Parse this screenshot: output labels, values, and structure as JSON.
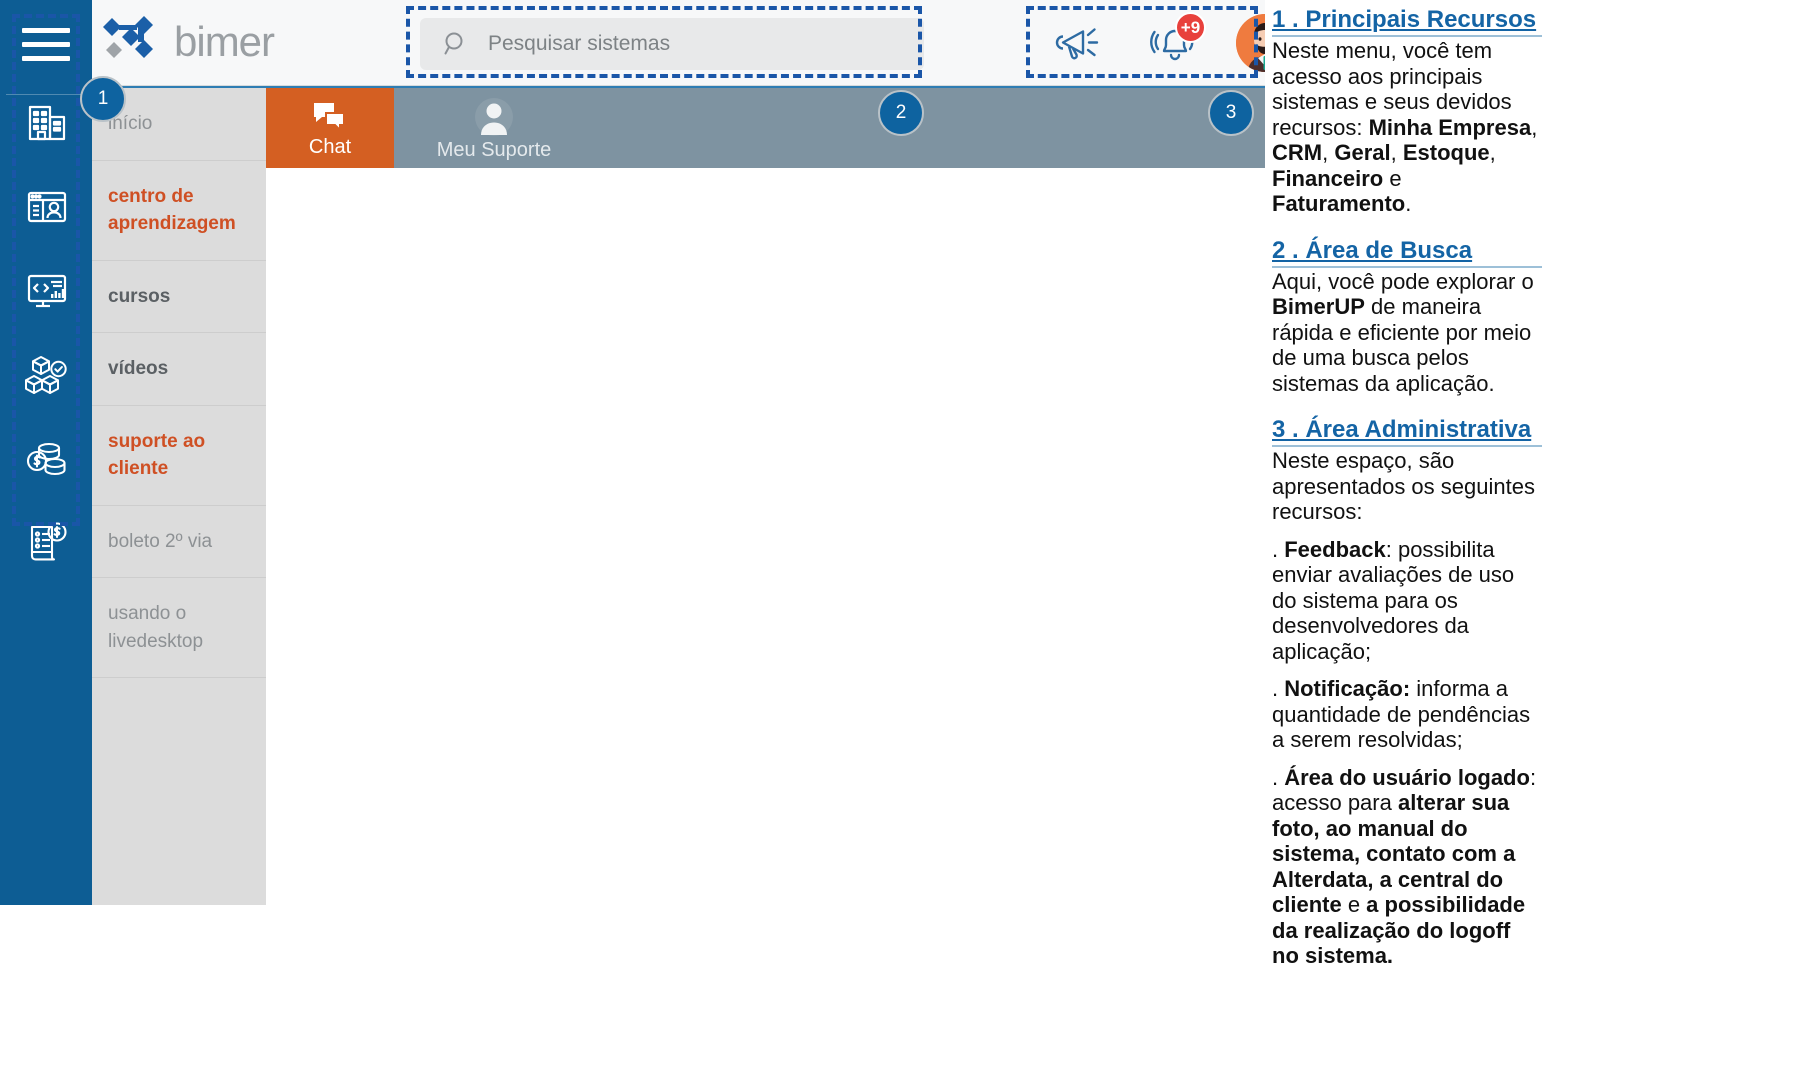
{
  "app": {
    "brand": "bimer",
    "brand_logo_icon": "bimer-logo-icon"
  },
  "icon_rail": {
    "menu_icon": "hamburger-menu-icon",
    "items": [
      {
        "icon": "building-icon",
        "label": "Minha Empresa"
      },
      {
        "icon": "contact-card-icon",
        "label": "CRM"
      },
      {
        "icon": "code-monitor-icon",
        "label": "Geral"
      },
      {
        "icon": "boxes-check-icon",
        "label": "Estoque"
      },
      {
        "icon": "coins-icon",
        "label": "Financeiro"
      },
      {
        "icon": "invoice-dollar-icon",
        "label": "Faturamento"
      }
    ]
  },
  "search": {
    "placeholder": "Pesquisar sistemas",
    "value": "",
    "icon": "search-icon"
  },
  "admin_area": {
    "feedback_icon": "megaphone-icon",
    "notification_icon": "bell-icon",
    "notification_badge": "+9",
    "avatar_icon": "user-avatar"
  },
  "left_nav": {
    "items": [
      {
        "label": "início",
        "style": "muted"
      },
      {
        "label": "centro de aprendizagem",
        "style": "accent"
      },
      {
        "label": "cursos",
        "style": "bold"
      },
      {
        "label": "vídeos",
        "style": "bold"
      },
      {
        "label": "suporte ao cliente",
        "style": "accent"
      },
      {
        "label": "boleto 2º via",
        "style": "muted"
      },
      {
        "label": "usando o livedesktop",
        "style": "muted"
      }
    ]
  },
  "tabs": [
    {
      "label": "Chat",
      "icon": "chat-bubbles-icon",
      "active": true
    },
    {
      "label": "Meu Suporte",
      "icon": "person-circle-icon",
      "active": false
    }
  ],
  "callouts": {
    "one": "1",
    "two": "2",
    "three": "3"
  },
  "notes": {
    "s1": {
      "heading": "1 . Principais Recursos",
      "body_1": "Neste menu, você tem acesso aos principais sistemas e seus devidos recursos: ",
      "b1": "Minha Empresa",
      "sep1": ", ",
      "b2": "CRM",
      "sep2": ", ",
      "b3": "Geral",
      "sep3": ", ",
      "b4": "Estoque",
      "sep4": ", ",
      "b5": "Financeiro",
      "sep5": " e ",
      "b6": "Faturamento",
      "end": "."
    },
    "s2": {
      "heading": "2 . Área de Busca",
      "body_1": "Aqui, você pode explorar o ",
      "b1": "BimerUP",
      "body_2": " de maneira rápida e eficiente por meio de uma busca pelos sistemas da aplicação."
    },
    "s3": {
      "heading": "3 . Área Administrativa",
      "body_1": "Neste espaço, são apresentados os seguintes recursos:",
      "i1_pre": ". ",
      "i1_b": "Feedback",
      "i1_post": ": possibilita enviar avaliações de uso do sistema para os desenvolvedores da aplicação;",
      "i2_pre": ". ",
      "i2_b": "Notificação:",
      "i2_post": " informa a quantidade de pendências a serem resolvidas;",
      "i3_pre": ". ",
      "i3_b": "Área do usuário logado",
      "i3_mid": ": acesso para ",
      "i3_b2": "alterar sua foto, ao manual do sistema, contato com a Alterdata, a central do cliente",
      "i3_mid2": " e ",
      "i3_b3": "a possibilidade da realização do logoff no sistema."
    }
  },
  "colors": {
    "brand_blue": "#0d5d94",
    "accent_orange": "#cf5024",
    "tab_active": "#d45f22",
    "tabbar": "#7e93a1",
    "note_heading": "#1464a5",
    "badge_red": "#e8413c",
    "highlight_dash": "#1a56a8"
  }
}
